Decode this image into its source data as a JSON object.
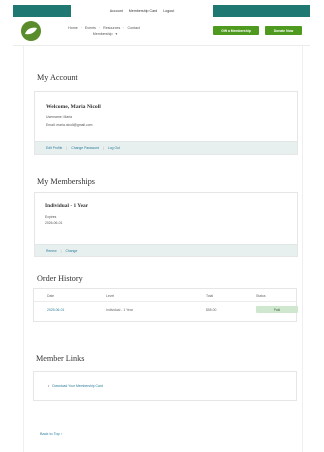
{
  "topbar": {
    "links": [
      "Account",
      "Membership Card",
      "Logout"
    ]
  },
  "header": {
    "nav_line1": [
      "Home",
      "Events",
      "Resources",
      "Contact"
    ],
    "nav_line2": "Membership",
    "gift_button": "Gift a Membership",
    "donate_button": "Donate Now",
    "accent_color": "#4e9a1e",
    "topbar_color": "#1f7872"
  },
  "account": {
    "title": "My Account",
    "welcome": "Welcome, Maria Nicoll",
    "username": "Username: Maria",
    "email": "Email: maria.nicoll@gmail.com",
    "footer_links": [
      "Edit Profile",
      "Change Password",
      "Log Out"
    ]
  },
  "memberships": {
    "title": "My Memberships",
    "level": "Individual - 1 Year",
    "expires_label": "Expires",
    "expires_date": "2026-06-01",
    "footer_links": [
      "Renew",
      "Change"
    ]
  },
  "order_history": {
    "title": "Order History",
    "columns": [
      "Date",
      "Level",
      "Total",
      "Status"
    ],
    "rows": [
      {
        "date": "2025-06-01",
        "level": "Individual - 1 Year",
        "total": "$55.00",
        "status": "Paid"
      }
    ]
  },
  "member_links": {
    "title": "Member Links",
    "items": [
      "Download Your Membership Card"
    ]
  },
  "back_to_top": "Back to Top ↑"
}
